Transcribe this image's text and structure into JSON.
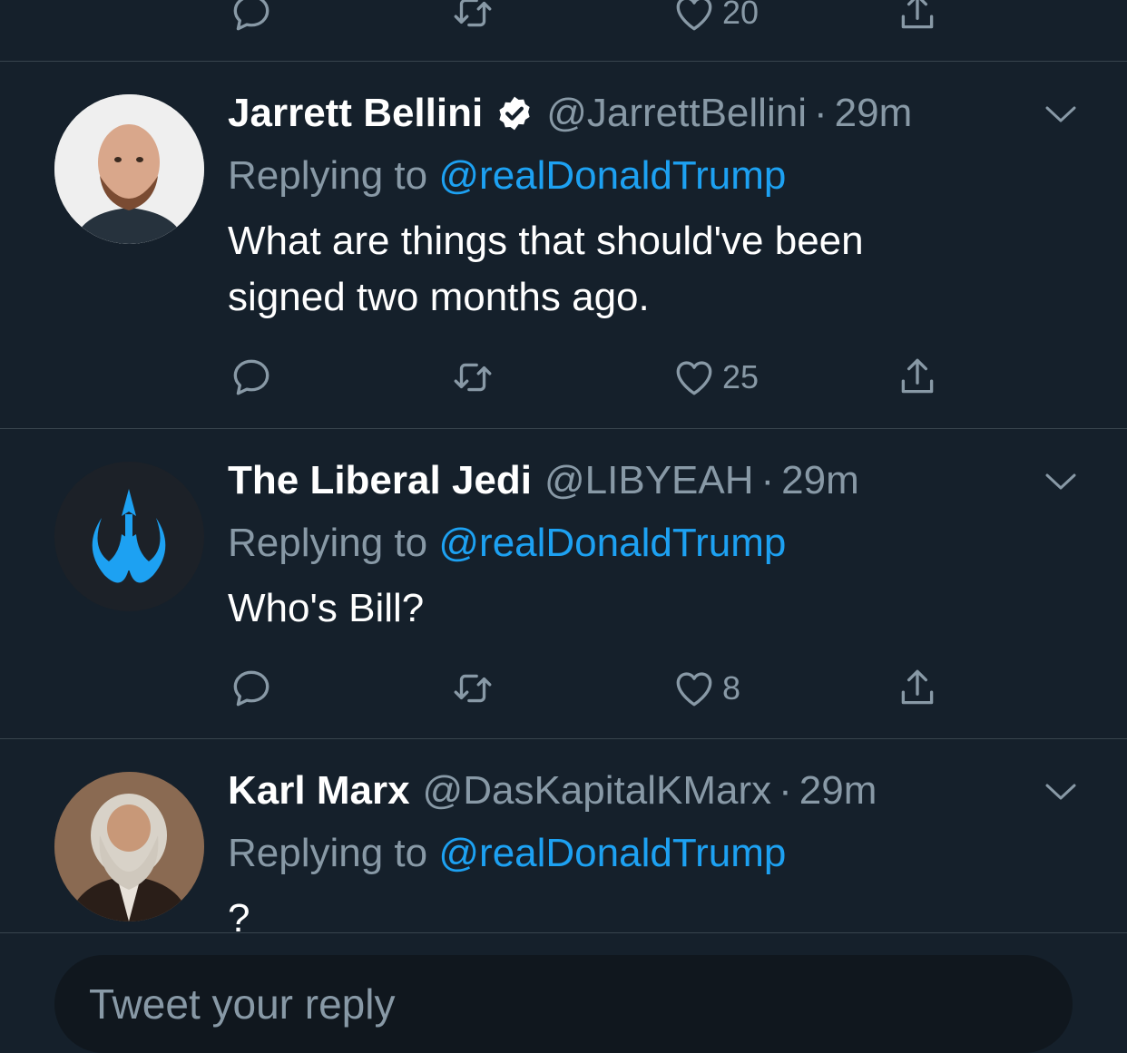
{
  "top_tweet": {
    "like_count": "20"
  },
  "tweets": [
    {
      "name": "Jarrett Bellini",
      "verified": true,
      "handle": "@JarrettBellini",
      "time": "29m",
      "replying_prefix": "Replying to",
      "replying_to": "@realDonaldTrump",
      "text_lines": [
        "What are things that should've been",
        "signed two months ago."
      ],
      "like_count": "25"
    },
    {
      "name": "The Liberal Jedi",
      "verified": false,
      "handle": "@LIBYEAH",
      "time": "29m",
      "replying_prefix": "Replying to",
      "replying_to": "@realDonaldTrump",
      "text_lines": [
        "Who's Bill?"
      ],
      "like_count": "8"
    },
    {
      "name": "Karl Marx",
      "verified": false,
      "handle": "@DasKapitalKMarx",
      "time": "29m",
      "replying_prefix": "Replying to",
      "replying_to": "@realDonaldTrump",
      "text_lines": [
        "?"
      ]
    }
  ],
  "reply_bar": {
    "placeholder": "Tweet your reply"
  },
  "icons": {
    "reply": "reply-icon",
    "retweet": "retweet-icon",
    "like": "heart-icon",
    "share": "share-icon",
    "caret": "chevron-down-icon",
    "verified": "verified-badge-icon"
  },
  "colors": {
    "background": "#15202b",
    "secondary_text": "#8899a6",
    "link": "#1da1f2",
    "divider": "#38444d"
  }
}
